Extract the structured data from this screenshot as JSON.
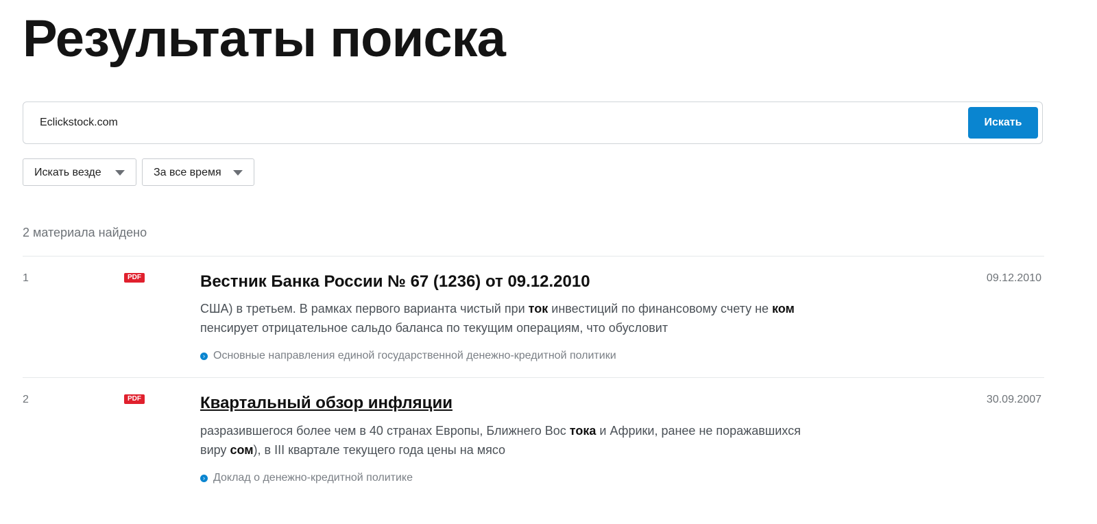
{
  "page": {
    "title": "Результаты поиска"
  },
  "search": {
    "value": "Eclickstock.com",
    "button_label": "Искать"
  },
  "filters": {
    "scope": {
      "selected": "Искать везде"
    },
    "period": {
      "selected": "За все время"
    }
  },
  "results_count": "2 материала найдено",
  "results": [
    {
      "number": "1",
      "badge": "PDF",
      "title": "Вестник Банка России № 67 (1236) от 09.12.2010",
      "date": "09.12.2010",
      "snippet_lines": [
        [
          {
            "text": "США) в третьем. В рамках первого варианта чистый при ",
            "bold": false
          },
          {
            "text": "ток",
            "bold": true
          },
          {
            "text": " инвестиций по финансовому счету не ",
            "bold": false
          },
          {
            "text": "ком",
            "bold": true
          }
        ],
        [
          {
            "text": "пенсирует отрицательное сальдо баланса по текущим операциям, что обусловит",
            "bold": false
          }
        ]
      ],
      "source": "Основные направления единой государственной денежно-кредитной политики"
    },
    {
      "number": "2",
      "badge": "PDF",
      "title": "Квартальный обзор инфляции",
      "date": "30.09.2007",
      "snippet_lines": [
        [
          {
            "text": "разразившегося более чем в 40 странах Европы, Ближнего Вос ",
            "bold": false
          },
          {
            "text": "тока",
            "bold": true
          },
          {
            "text": " и Африки, ранее не поражавшихся",
            "bold": false
          }
        ],
        [
          {
            "text": "виру ",
            "bold": false
          },
          {
            "text": "сом",
            "bold": true
          },
          {
            "text": "), в III квартале текущего года цены на мясо",
            "bold": false
          }
        ]
      ],
      "source": "Доклад о денежно-кредитной политике"
    }
  ]
}
